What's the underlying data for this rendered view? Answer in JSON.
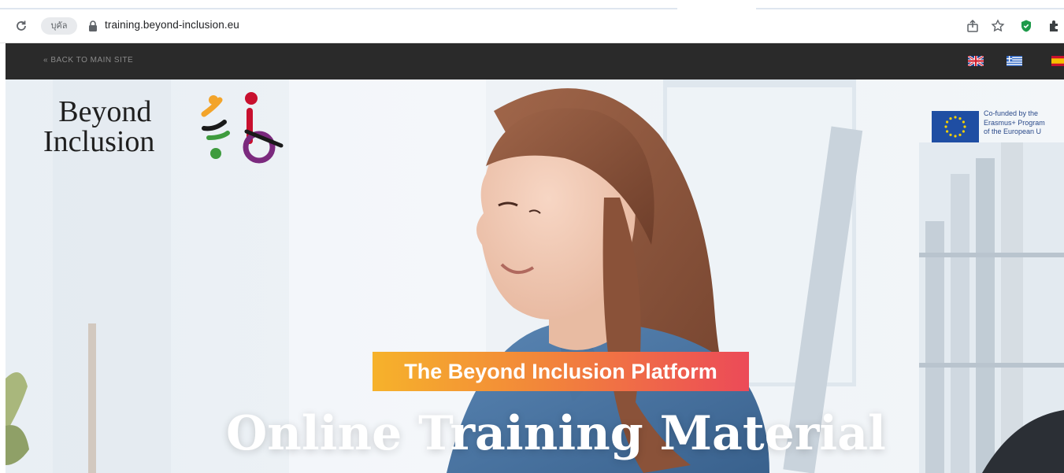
{
  "browser": {
    "chip_label": "บุคัล",
    "url": "training.beyond-inclusion.eu",
    "icons": [
      "reload-icon",
      "lock-icon",
      "share-icon",
      "star-icon",
      "shield-extension-icon",
      "puzzle-extension-icon"
    ]
  },
  "topbar": {
    "back_link": "« BACK TO MAIN SITE",
    "languages": [
      "English",
      "Greek",
      "Spanish"
    ]
  },
  "logo": {
    "line1": "Beyond",
    "line2": "Inclusion",
    "colors": [
      "#f3a42a",
      "#c8102e",
      "#3e9b3e",
      "#7b2a7e",
      "#1a1a1a"
    ]
  },
  "eu_badge": {
    "line1": "Co-funded by the",
    "line2": "Erasmus+ Program",
    "line3": "of the European U"
  },
  "hero": {
    "tagline": "The Beyond Inclusion Platform",
    "title": "Online Training Material"
  },
  "colors": {
    "topbar_bg": "#2a2a2a",
    "tagline_start": "#f6b22b",
    "tagline_end": "#ec4a58",
    "eu_blue": "#1f4ea3"
  }
}
